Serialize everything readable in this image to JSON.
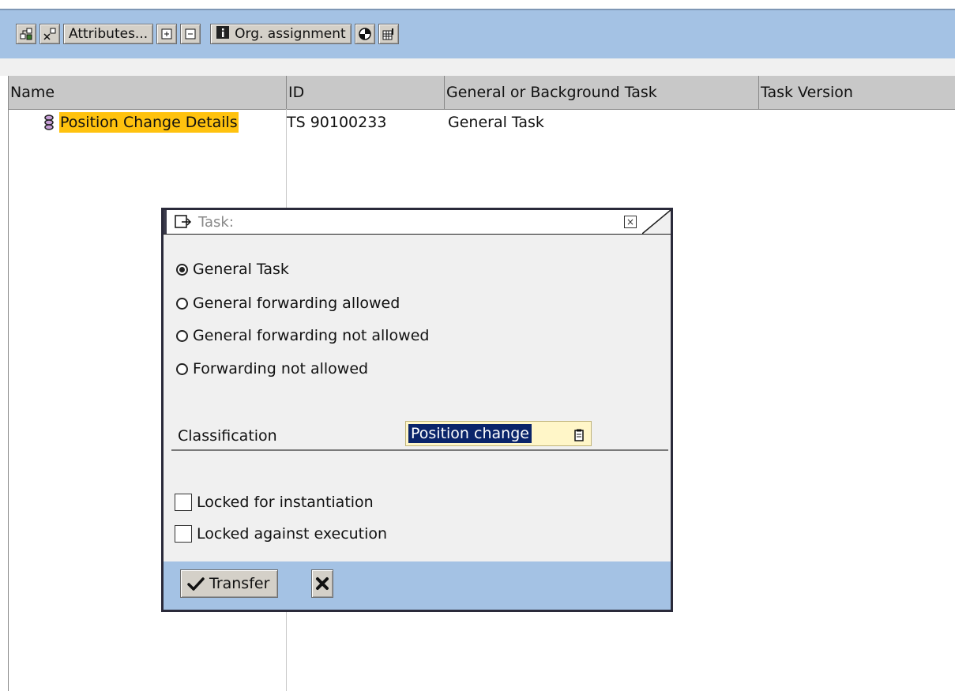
{
  "toolbar": {
    "attributes_label": "Attributes...",
    "org_assignment_label": "Org. assignment"
  },
  "table": {
    "columns": [
      "Name",
      "ID",
      "General or Background Task",
      "Task Version"
    ],
    "rows": [
      {
        "name": "Position Change Details",
        "id": "TS 90100233",
        "task_type": "General Task",
        "version": ""
      }
    ]
  },
  "dialog": {
    "title": "Task:",
    "options": [
      {
        "label": "General Task",
        "checked": true
      },
      {
        "label": "General forwarding allowed",
        "checked": false
      },
      {
        "label": "General forwarding not allowed",
        "checked": false
      },
      {
        "label": "Forwarding not allowed",
        "checked": false
      }
    ],
    "classification_label": "Classification",
    "classification_value": "Position change",
    "checkboxes": [
      {
        "label": "Locked for instantiation",
        "checked": false
      },
      {
        "label": "Locked against execution",
        "checked": false
      }
    ],
    "transfer_label": "Transfer"
  },
  "colors": {
    "toolbar_bg": "#a4c2e4",
    "highlight": "#ffc20e",
    "selection": "#0a246a"
  }
}
